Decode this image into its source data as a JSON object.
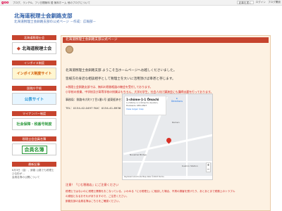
{
  "topbar": {
    "logo": "goo",
    "promo": "ブログ、ランチ&、フリ日間無料 愛 無料ホーム 他のブログについて",
    "right_items": [
      "記事を書く",
      "ログイン",
      "ブログ開設"
    ]
  },
  "site": {
    "title": "北海道税理士会釧路支部",
    "subtitle": "北海道税理士会釧路支部の公式ページ  －作成：広報部－"
  },
  "sidebar": {
    "sections": [
      {
        "header": "北海道税理士会",
        "banner": "北海道税理士会",
        "style": "b1"
      },
      {
        "header": "インボイス制度",
        "banner": "インボイス制度サイト",
        "style": "b2"
      },
      {
        "header": "国税庁手続",
        "banner": "公表サイト",
        "style": "b3"
      },
      {
        "header": "マイナンバー制度",
        "banner": "社会保障・税番号制度",
        "style": "b4"
      },
      {
        "header": "税理士会会員名簿",
        "banner": "会員名簿",
        "style": "b5"
      }
    ],
    "news_header": "最新記事",
    "news_items": [
      "8月3日（金）、釧路 公路でも税理士ひな形が…",
      "会員名簿の公開について"
    ]
  },
  "main": {
    "header": "北海道税理士会釧路支部公式ページ",
    "greeting": "北海道税理士会釧路支部  ようこそ当ホームページへお越しくださいました。",
    "line1": "皆様方の身近な相談相手として税理士を大いに活用頂けば幸甚と存じます。",
    "red1": "※税理士会釧路支部では、無料の税務相談の機会を受付しております。",
    "red2": "小学校の授業、中学校及び高等学校の授業はもちろん、大学の学生、社会人向け講演会にも講師派遣を行っております。",
    "office": "事務局：釧路市大町7丁目1番1号  道東経済センタービル5階",
    "tel": "TEL：0154-42-0497 FAX：0154-41-8936",
    "notice": "注意！「じむ税務店」にご注意ください",
    "note1": "税理士ではないのに税理士業務をおこなっている、いわゆる「にせ税理士」に相談した場合、不測の損害を受けたり、あとあとまで税務上のトラブル",
    "note2": "の原因となるおそれがありますので、ご注意ください。",
    "note3": "釧路支部の会員名簿はこちらをご確認ください。"
  },
  "map": {
    "place_name": "1-chōme-1-1 Ōmachi",
    "address1": "1-chōme-1-1 Ōmachi, Kushiro,",
    "address2": "Hokkaido 085-0847",
    "view_larger": "View larger map",
    "directions": "Directions",
    "label1": "Ramen",
    "label2": "Kushiro Station",
    "label3": "Nusamai Bridge",
    "footer": "Keyboard shortcuts  Map data ©2023  Terms"
  },
  "colors": {
    "accent": "#c6442e",
    "title": "#2f5fa8",
    "bg_main": "#fdf1e2"
  }
}
